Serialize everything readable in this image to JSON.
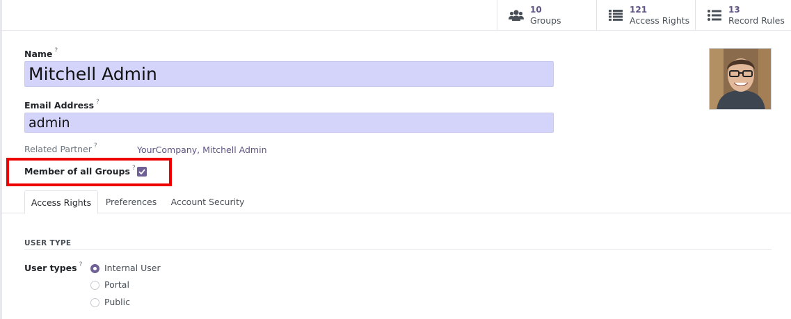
{
  "stats": [
    {
      "count": "10",
      "label": "Groups",
      "icon": "users-icon"
    },
    {
      "count": "121",
      "label": "Access Rights",
      "icon": "list-icon"
    },
    {
      "count": "13",
      "label": "Record Rules",
      "icon": "list-ul-icon"
    }
  ],
  "form": {
    "name_label": "Name",
    "name_value": "Mitchell Admin",
    "email_label": "Email Address",
    "email_value": "admin",
    "help_marker": "?",
    "related_partner_label": "Related Partner",
    "related_partner_value": "YourCompany, Mitchell Admin",
    "member_all_groups_label": "Member of all Groups",
    "member_all_groups_checked": true
  },
  "tabs": [
    {
      "label": "Access Rights",
      "active": true
    },
    {
      "label": "Preferences",
      "active": false
    },
    {
      "label": "Account Security",
      "active": false
    }
  ],
  "user_type": {
    "section_title": "USER TYPE",
    "field_label": "User types",
    "options": [
      {
        "label": "Internal User",
        "selected": true
      },
      {
        "label": "Portal",
        "selected": false
      },
      {
        "label": "Public",
        "selected": false
      }
    ]
  },
  "colors": {
    "accent": "#5e5383",
    "input_bg": "#d4d4fb",
    "highlight_box": "#ee0000"
  }
}
